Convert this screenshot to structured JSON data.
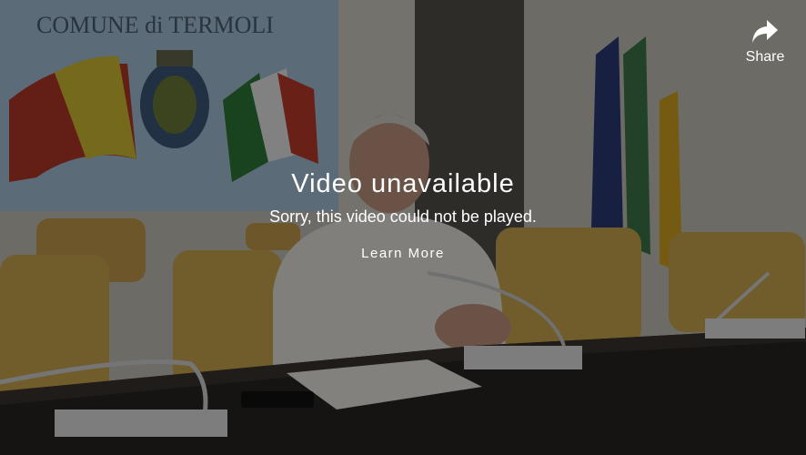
{
  "error": {
    "title": "Video unavailable",
    "message": "Sorry, this video could not be played.",
    "learn_more": "Learn More"
  },
  "share": {
    "label": "Share",
    "icon": "share-arrow-icon"
  },
  "backdrop": {
    "banner_text": "COMUNE di TERMOLI"
  }
}
